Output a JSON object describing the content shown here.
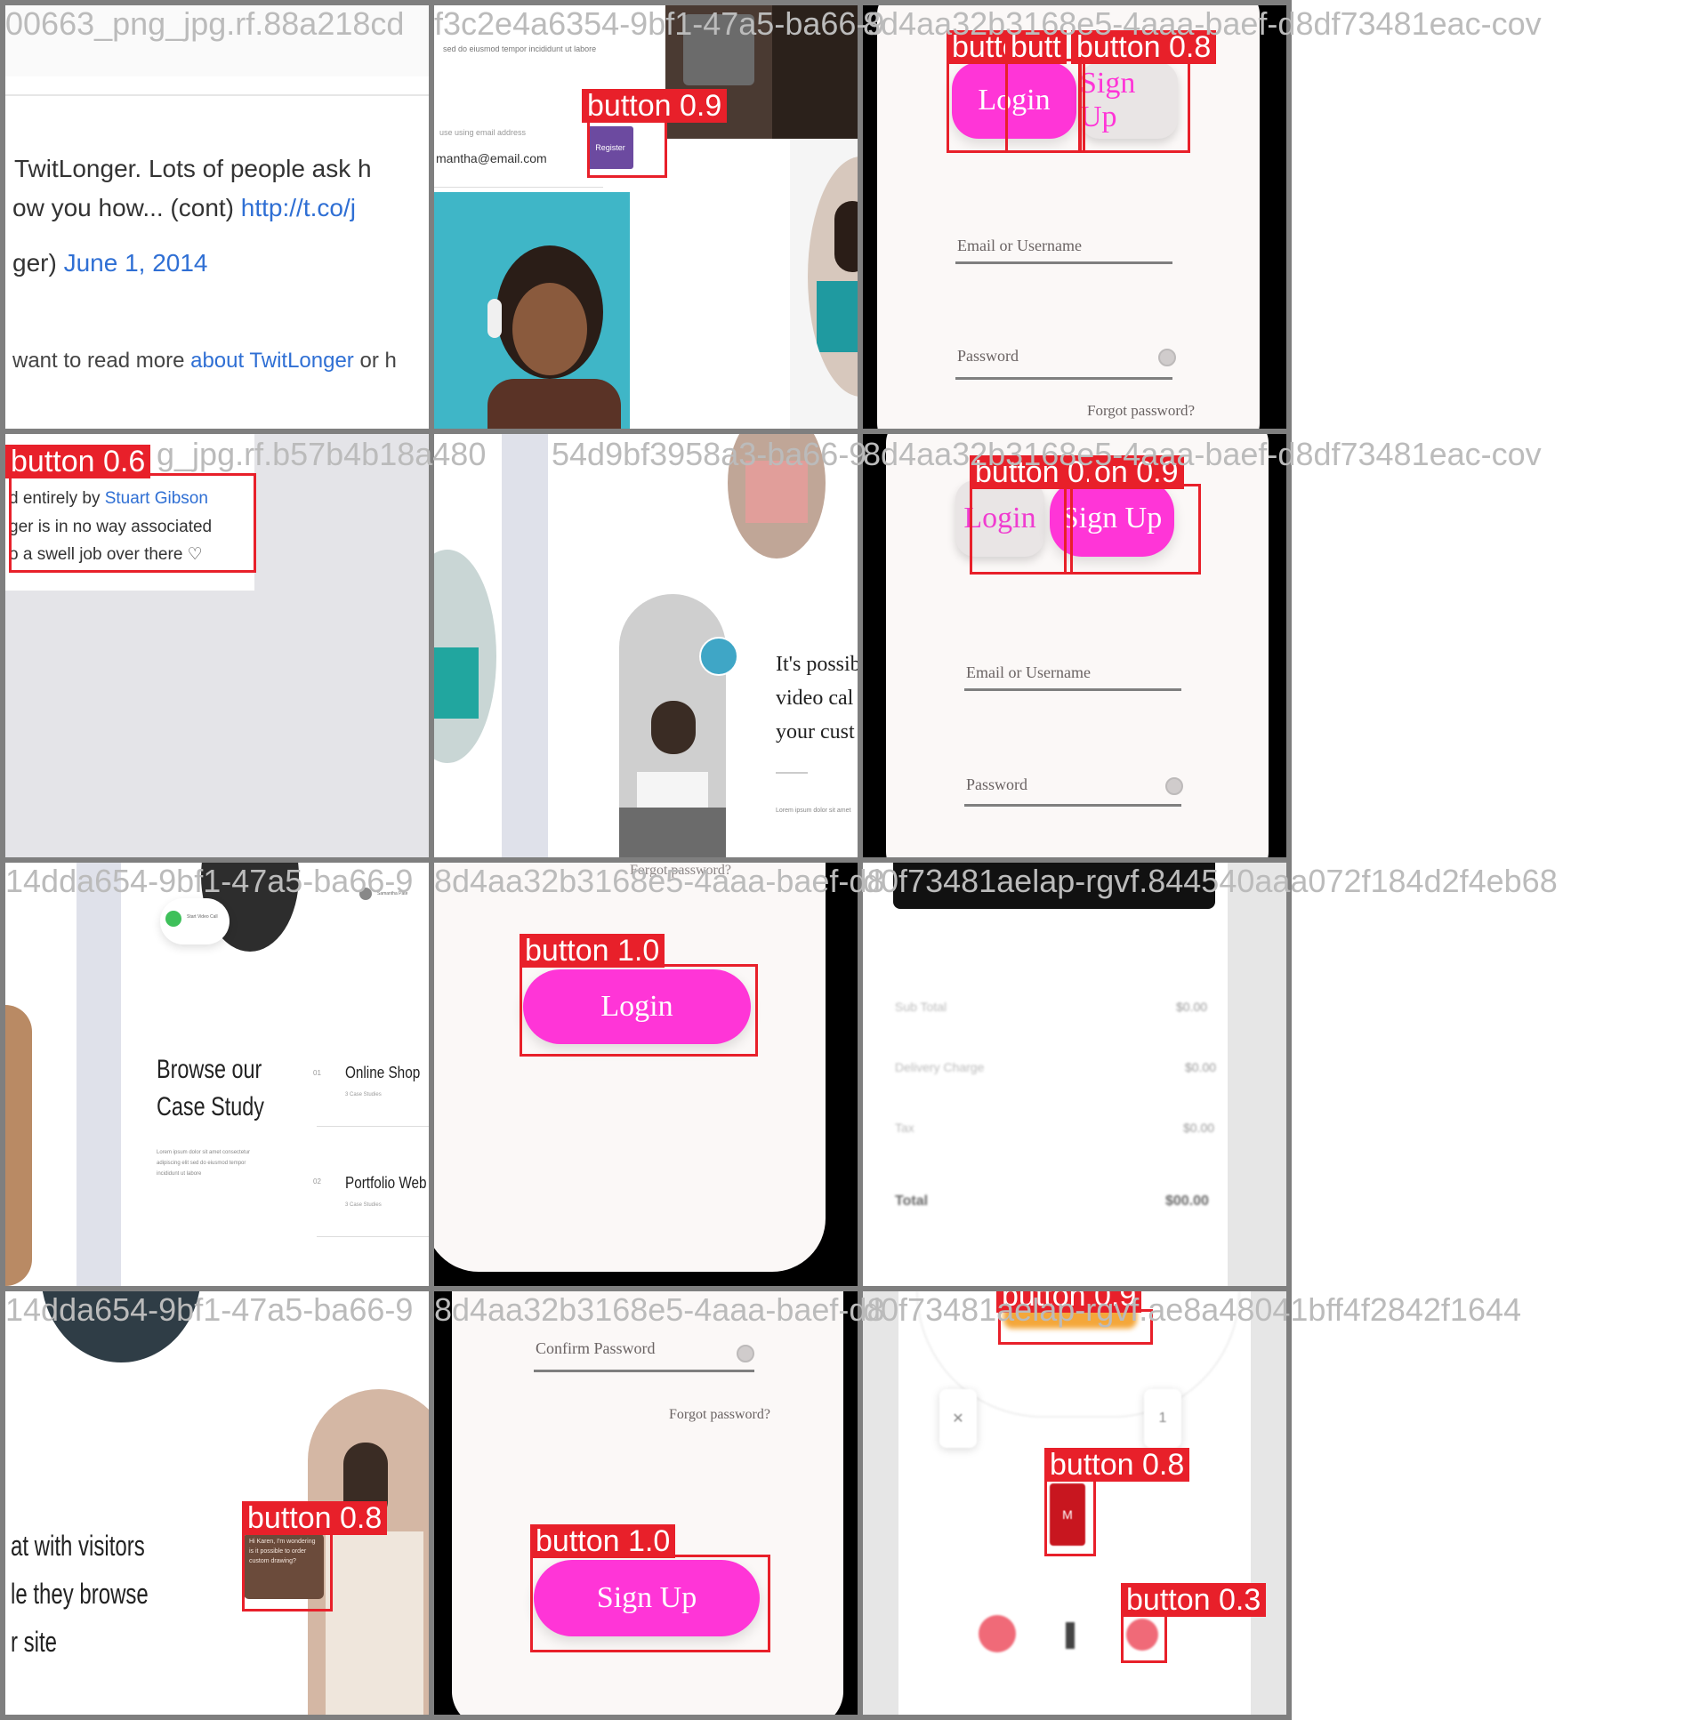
{
  "tiles": [
    {
      "filename": "00663_png_jpg.rf.88a218cd",
      "text": {
        "line1": "TwitLonger. Lots of people ask h",
        "line2a": "ow you how... (cont) ",
        "line2b": "http://t.co/j",
        "line3a": "ger) ",
        "line3b": "June 1, 2014",
        "line4a": "want to read more ",
        "line4b": "about TwitLonger",
        "line4c": " or h"
      },
      "detections": []
    },
    {
      "filename": "f3c2e4a6354-9bf1-47a5-ba66-9",
      "text": {
        "top": "sed do eiusmod tempor incididunt ut labore",
        "hint": "use using email address",
        "email": "mantha@email.com",
        "register": "Register"
      },
      "detections": [
        {
          "label": "button 0.9"
        }
      ]
    },
    {
      "filename": "8d4aa32b3168e5-4aaa-baef-d8df73481eac-cov",
      "text": {
        "login": "Login",
        "signup": "Sign Up",
        "email": "Email or Username",
        "password": "Password",
        "forgot": "Forgot password?"
      },
      "detections": [
        {
          "label": "button 0.8"
        },
        {
          "label": "butt"
        },
        {
          "label": "butto"
        }
      ]
    },
    {
      "filename": "g_jpg.rf.b57b4b18a480",
      "text": {
        "l1a": "d entirely by ",
        "l1b": "Stuart Gibson",
        "l2": "ger is in no way associated",
        "l3": "o a swell job over there ♡"
      },
      "detections": [
        {
          "label": "button 0.6"
        }
      ]
    },
    {
      "filename": "54d9bf3958a3-ba66-9",
      "text": {
        "p1": "It's possib",
        "p2": "video cal",
        "p3": "your cust",
        "small": "Lorem ipsum dolor sit amet"
      },
      "detections": []
    },
    {
      "filename": "8d4aa32b3168e5-4aaa-baef-d8df73481eac-cov",
      "text": {
        "login": "Login",
        "signup": "Sign Up",
        "email": "Email or Username",
        "password": "Password"
      },
      "detections": [
        {
          "label": "button 0.9"
        },
        {
          "label": "on 0.9"
        }
      ]
    },
    {
      "filename": "14dda654-9bf1-47a5-ba66-9",
      "text": {
        "h1": "Browse our",
        "h2": "Case Study",
        "para": "Lorem ipsum dolor sit amet consectetur adipiscing elit sed do eiusmod tempor incididunt ut labore",
        "n1": "01",
        "s1": "Online Shop",
        "c1": "3 Case Studies",
        "n2": "02",
        "s2": "Portfolio Web",
        "c2": "3 Case Studies",
        "chatname": "Samantha Pate",
        "chatmsg": "Start Video Call"
      },
      "detections": []
    },
    {
      "filename": "8d4aa32b3168e5-4aaa-baef-d8",
      "text": {
        "forgot": "Forgot password?",
        "login": "Login"
      },
      "detections": [
        {
          "label": "button 1.0"
        }
      ]
    },
    {
      "filename": "d0f73481aelap-rgvf.844540aaa072f184d2f4eb68",
      "text": {
        "r1l": "Sub Total",
        "r1v": "$0.00",
        "r2l": "Delivery Charge",
        "r2v": "$0.00",
        "r3l": "Tax",
        "r3v": "$0.00",
        "r4l": "Total",
        "r4v": "$00.00"
      },
      "detections": []
    },
    {
      "filename": "14dda654-9bf1-47a5-ba66-9",
      "text": {
        "p1": "at with visitors",
        "p2": "le they browse",
        "p3": "r site",
        "msg": "Hi Karen, I'm wondering is it possible to order custom drawing?"
      },
      "detections": [
        {
          "label": "button 0.8"
        }
      ]
    },
    {
      "filename": "8d4aa32b3168e5-4aaa-baef-d8",
      "text": {
        "confirm": "Confirm Password",
        "forgot": "Forgot password?",
        "signup": "Sign Up"
      },
      "detections": [
        {
          "label": "button 1.0"
        }
      ]
    },
    {
      "filename": "d0f73481aelap-rgvf.ae8a48041bff4f2842f1644",
      "text": {
        "k1": "✕",
        "k2": "1",
        "mid": "M"
      },
      "detections": [
        {
          "label": "button 0.9"
        },
        {
          "label": "button 0.8"
        },
        {
          "label": "button 0.3"
        }
      ]
    }
  ],
  "colors": {
    "box": "#e8202a",
    "pink": "#ff35d7",
    "border": "#7f7f7f",
    "link": "#2f6fd4"
  }
}
